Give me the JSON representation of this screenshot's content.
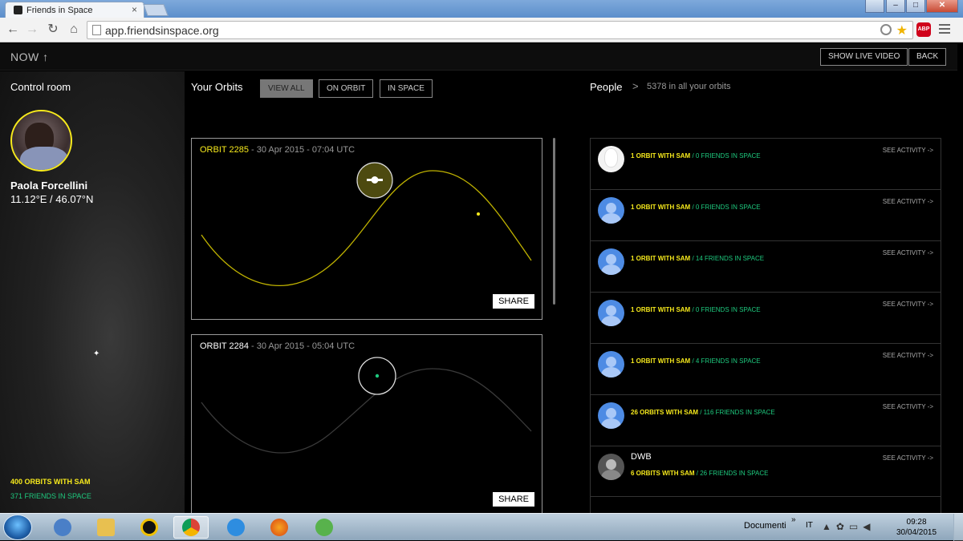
{
  "browser": {
    "tab_title": "Friends in Space",
    "tab_close": "×",
    "url": "app.friendsinspace.org",
    "abp": "ABP"
  },
  "app": {
    "now_label": "NOW ↑",
    "show_live_video": "SHOW LIVE VIDEO",
    "back": "BACK"
  },
  "control_room": {
    "title": "Control room",
    "user_name": "Paola Forcellini",
    "coords": "11.12°E / 46.07°N",
    "orbits_stat": "400 ORBITS WITH SAM",
    "friends_stat": "371 FRIENDS IN SPACE"
  },
  "orbits": {
    "title": "Your Orbits",
    "filters": [
      "VIEW ALL",
      "ON ORBIT",
      "IN SPACE"
    ],
    "active_filter": "VIEW ALL",
    "cards": [
      {
        "number": "ORBIT 2285",
        "date": " - 30 Apr 2015 - 07:04 UTC",
        "share": "SHARE",
        "highlight": true
      },
      {
        "number": "ORBIT 2284",
        "date": " - 30 Apr 2015 - 05:04 UTC",
        "share": "SHARE",
        "highlight": false
      }
    ]
  },
  "people": {
    "title": "People",
    "chevron": ">",
    "count": "5378 in all your orbits",
    "see_activity": "SEE ACTIVITY ->",
    "rows": [
      {
        "name": "",
        "orbits": "1 ORBIT WITH SAM",
        "friends": " / 0 FRIENDS IN SPACE",
        "avatar": "white"
      },
      {
        "name": "",
        "orbits": "1 ORBIT WITH SAM",
        "friends": " / 0 FRIENDS IN SPACE",
        "avatar": "default"
      },
      {
        "name": "",
        "orbits": "1 ORBIT WITH SAM",
        "friends": " / 14 FRIENDS IN SPACE",
        "avatar": "default"
      },
      {
        "name": "",
        "orbits": "1 ORBIT WITH SAM",
        "friends": " / 0 FRIENDS IN SPACE",
        "avatar": "default"
      },
      {
        "name": "",
        "orbits": "1 ORBIT WITH SAM",
        "friends": " / 4 FRIENDS IN SPACE",
        "avatar": "default"
      },
      {
        "name": "",
        "orbits": "26 ORBITS WITH SAM",
        "friends": " / 116 FRIENDS IN SPACE",
        "avatar": "default"
      },
      {
        "name": "DWB",
        "orbits": "6 ORBITS WITH SAM",
        "friends": " / 26 FRIENDS IN SPACE",
        "avatar": "photo"
      }
    ]
  },
  "taskbar": {
    "documents": "Documenti",
    "chevrons": "»",
    "lang": "IT",
    "time": "09:28",
    "date": "30/04/2015"
  },
  "colors": {
    "accent_yellow": "#f7ea1c",
    "accent_green": "#1ec97e"
  }
}
